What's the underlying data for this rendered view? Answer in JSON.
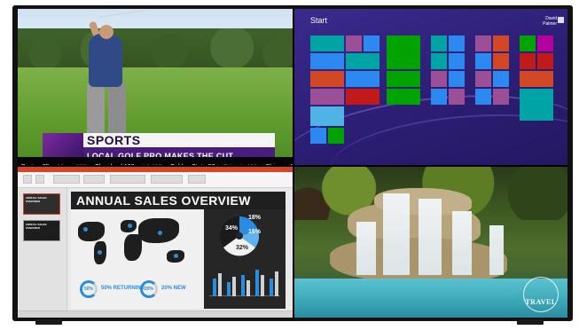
{
  "sports": {
    "headline": "SPORTS",
    "subheadline": "LOCAL GOLF PRO MAKES THE CUT",
    "ticker": [
      {
        "text": "Boston 85",
        "lose": false
      },
      {
        "text": "Miami 108",
        "lose": true
      },
      {
        "text": "Cleveland 100",
        "lose": false
      },
      {
        "text": "LA 112",
        "lose": true
      },
      {
        "text": "Golden State 97",
        "lose": false
      },
      {
        "text": "Orlando 116",
        "lose": true
      },
      {
        "text": "Chicago 110",
        "lose": false
      },
      {
        "text": "Washington 9",
        "lose": true
      }
    ],
    "ticker_separator": "•"
  },
  "start_screen": {
    "title": "Start",
    "user_first": "David",
    "user_last": "Palmer",
    "colors": {
      "teal": "#00a4a4",
      "green": "#00a300",
      "purple": "#9b4f96",
      "orange": "#d24726",
      "blue": "#2d89ef",
      "red": "#c11a1a",
      "magenta": "#b4009e",
      "lightblue": "#4fb3e4"
    }
  },
  "presentation": {
    "slide_title": "ANNUAL SALES OVERVIEW",
    "thumb_titles": [
      "ANNUAL SALES OVERVIEW",
      "ANNUAL SALES OVERVIEW"
    ],
    "pie_values": [
      "18%",
      "34%",
      "16%",
      "32%"
    ],
    "stat_returning": "50% RETURNING",
    "stat_new": "20% NEW",
    "ring_returning": "50%",
    "ring_new": "20%",
    "accent": "#2a8ce0"
  },
  "travel": {
    "logo_text": "TRAVEL"
  }
}
